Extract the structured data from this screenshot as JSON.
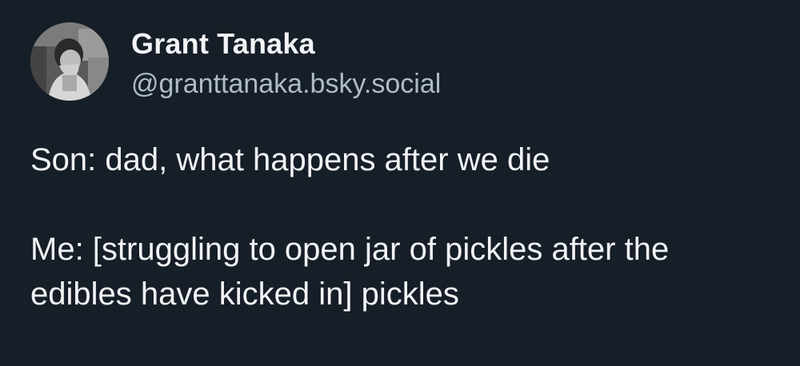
{
  "author": {
    "display_name": "Grant Tanaka",
    "handle": "@granttanaka.bsky.social",
    "avatar_icon": "user-avatar-photo"
  },
  "post": {
    "line1": "Son: dad, what happens after we die",
    "line2": "Me: [struggling to open jar of pickles after the edibles have kicked in] pickles"
  },
  "colors": {
    "background": "#161e27",
    "text": "#f1f3f5",
    "handle": "#aebbc9"
  }
}
